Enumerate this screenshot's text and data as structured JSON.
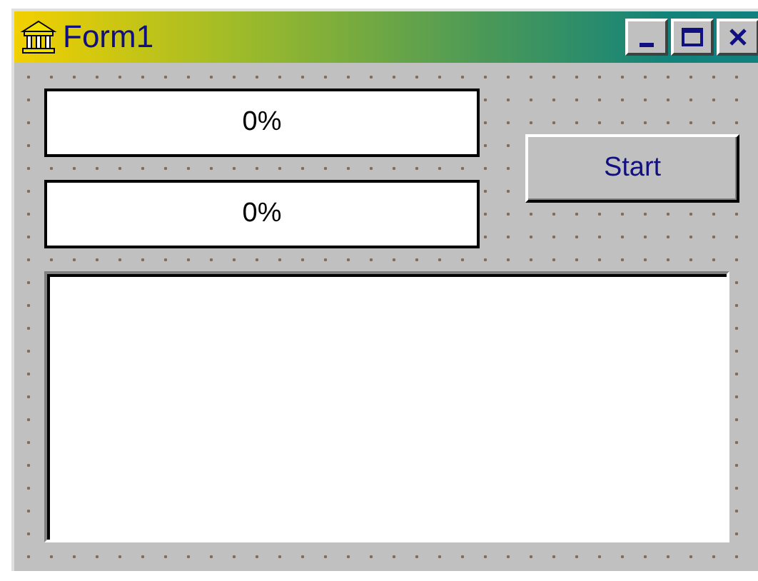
{
  "window": {
    "title": "Form1"
  },
  "progress_bars": [
    {
      "label": "0%",
      "level": 0
    },
    {
      "label": "0%",
      "level": 0
    }
  ],
  "start_button": {
    "label": "Start"
  }
}
